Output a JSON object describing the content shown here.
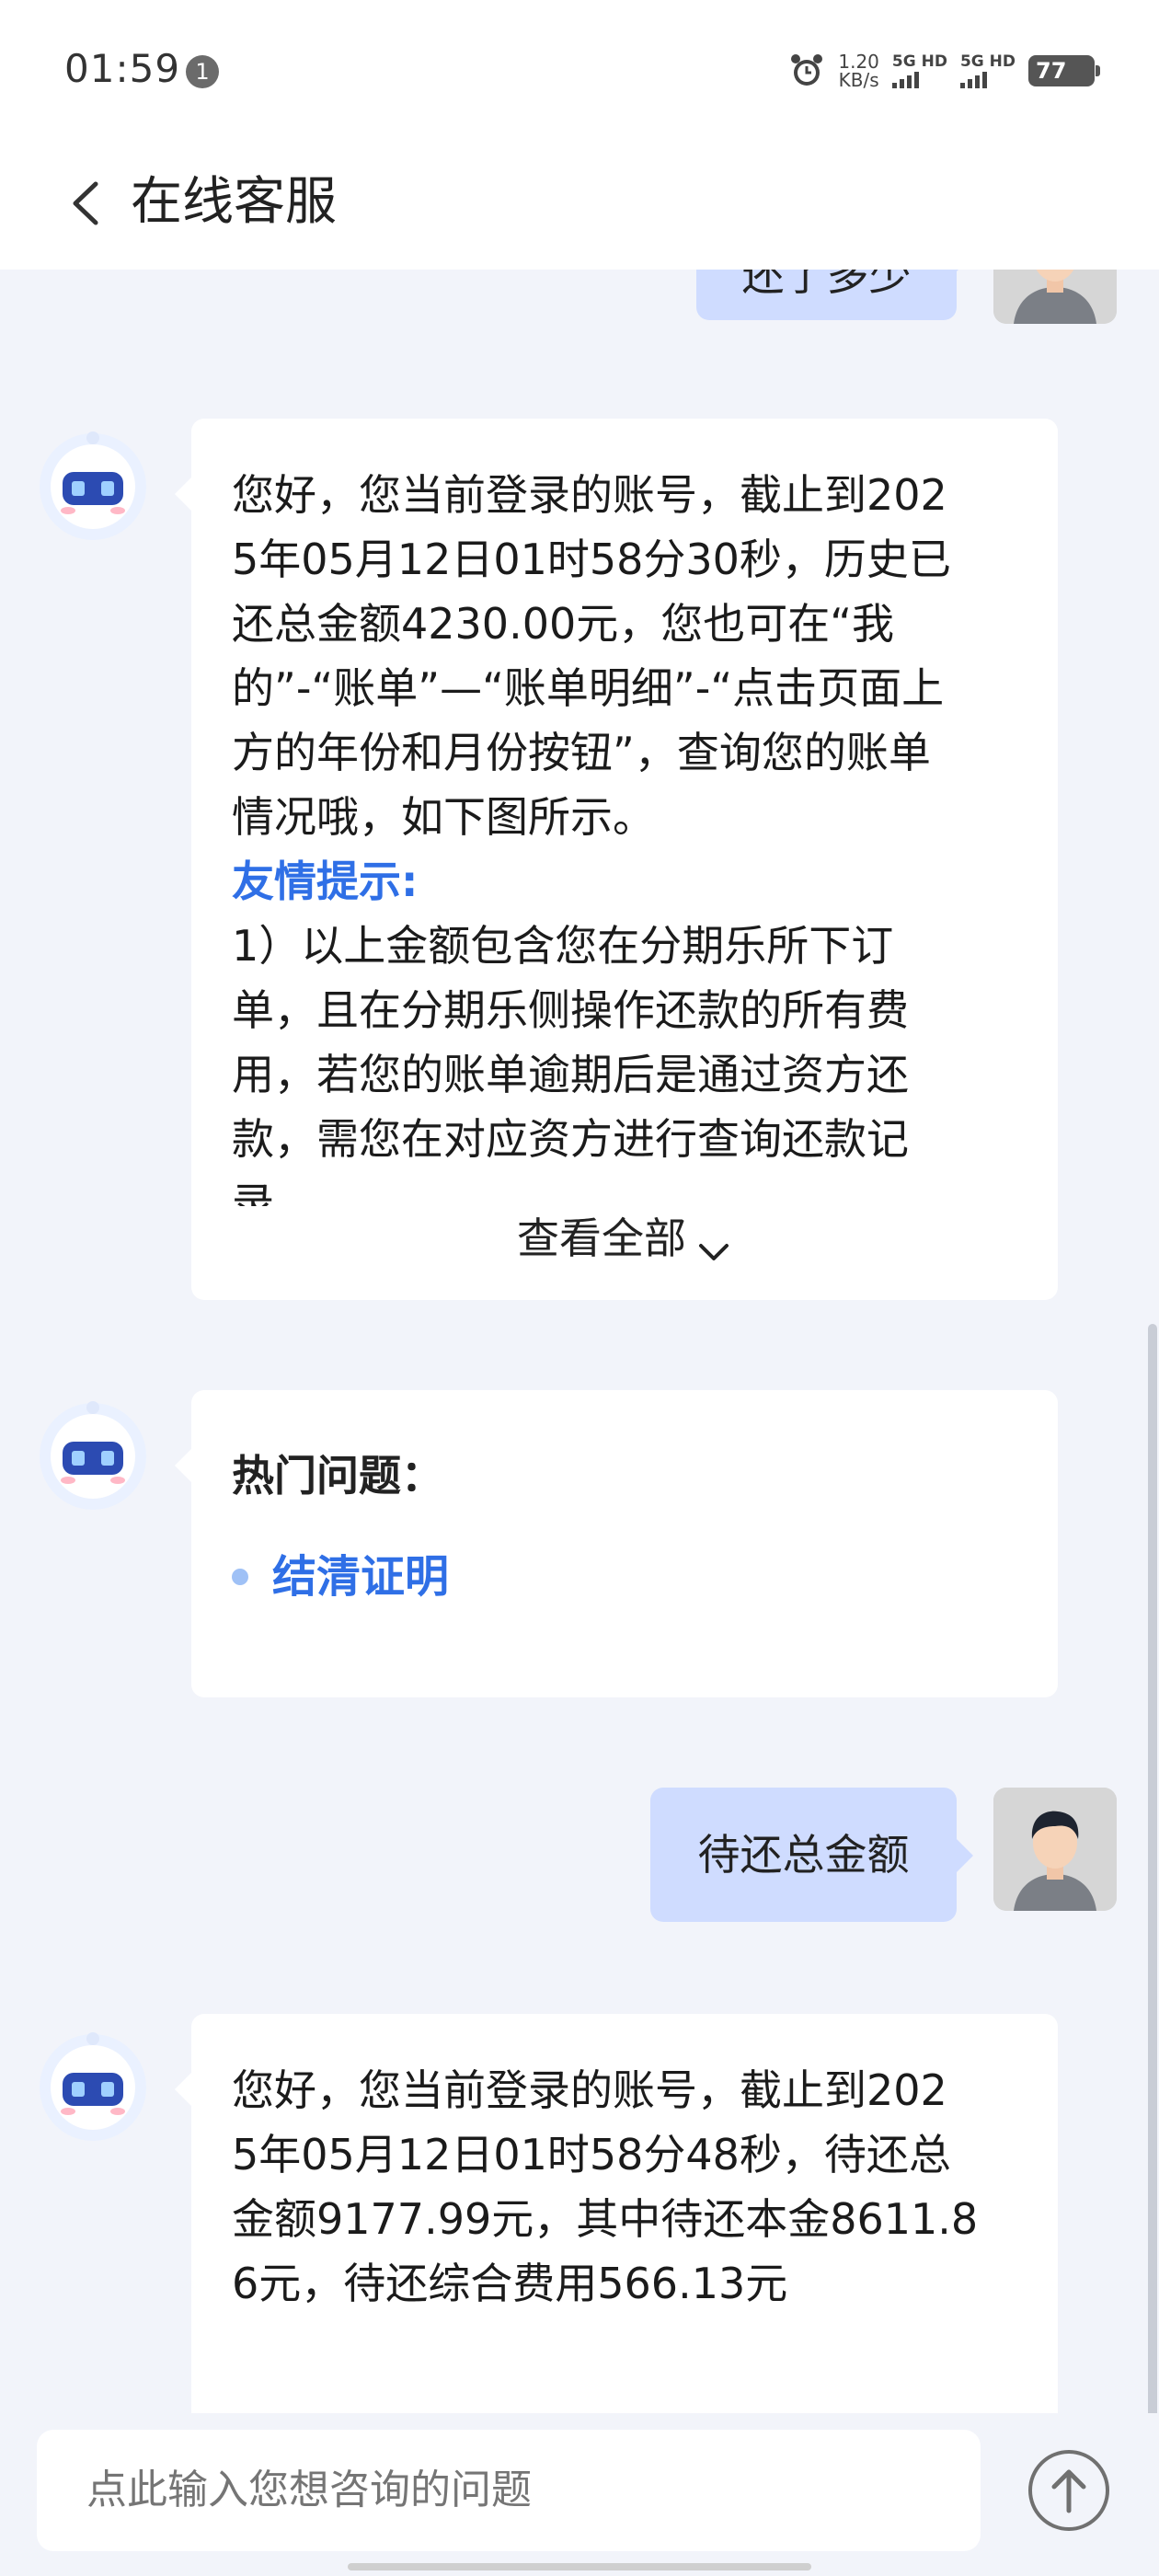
{
  "status_bar": {
    "time": "01:59",
    "notification_count": "1",
    "net_speed_value": "1.20",
    "net_speed_unit": "KB/s",
    "sim1_label": "5G HD",
    "sim2_label": "5G HD",
    "battery": "77"
  },
  "header": {
    "title": "在线客服"
  },
  "messages": {
    "user_partial": "还了多少",
    "bot_reply_1": {
      "lines": [
        "您好，您当前登录的账号，截止到202",
        "5年05月12日01时58分30秒，历史已",
        "还总金额4230.00元，您也可在“我",
        "的”-“账单”—“账单明细”-“点击页面上",
        "方的年份和月份按钮”，查询您的账单",
        "情况哦，如下图所示。"
      ],
      "tip_heading": "友情提示:",
      "tip_lines": [
        "1）以上金额包含您在分期乐所下订",
        "单，且在分期乐侧操作还款的所有费",
        "用，若您的账单逾期后是通过资方还",
        "款，需您在对应资方进行查询还款记",
        "录"
      ],
      "view_all": "查看全部"
    },
    "hot_questions": {
      "title": "热门问题：",
      "items": [
        "结清证明"
      ]
    },
    "user_message": "待还总金额",
    "bot_reply_2": {
      "lines": [
        "您好，您当前登录的账号，截止到202",
        "5年05月12日01时58分48秒，待还总",
        "金额9177.99元，其中待还本金8611.8",
        "6元，待还综合费用566.13元"
      ]
    }
  },
  "input": {
    "placeholder": "点此输入您想咨询的问题"
  },
  "colors": {
    "accent": "#2f6fe6",
    "user_bubble": "#cfdcff",
    "background": "#f2f4fa"
  },
  "icons": {
    "back": "chevron-left-icon",
    "send": "arrow-up-circle-icon",
    "bot": "robot-avatar-icon",
    "alarm": "alarm-icon"
  }
}
